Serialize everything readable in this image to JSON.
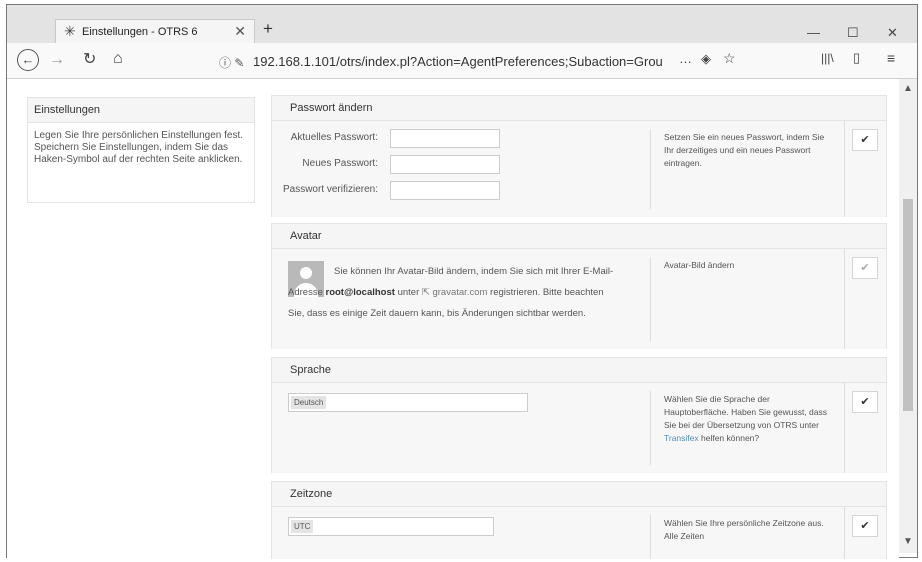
{
  "browser": {
    "tab_title": "Einstellungen - OTRS 6",
    "url_display": "192.168.1.101/otrs/index.pl?Action=AgentPreferences;Subaction=Grou",
    "page_actions": "…",
    "new_tab": "+",
    "minimize": "—",
    "maximize": "☐",
    "close": "✕"
  },
  "sidebar": {
    "title": "Einstellungen",
    "text": "Legen Sie Ihre persönlichen Einstellungen fest. Speichern Sie Einstellungen, indem Sie das Haken-Symbol auf der rechten Seite anklicken."
  },
  "password": {
    "title": "Passwort ändern",
    "current_label": "Aktuelles Passwort:",
    "new_label": "Neues Passwort:",
    "verify_label": "Passwort verifizieren:",
    "help": "Setzen Sie ein neues Passwort, indem Sie Ihr derzeitiges und ein neues Passwort eintragen."
  },
  "avatar": {
    "title": "Avatar",
    "text_before": "Sie können Ihr Avatar-Bild ändern, indem Sie sich mit Ihrer E-Mail-Adresse ",
    "email": "root@localhost",
    "text_mid": " unter ",
    "link": "gravatar.com",
    "text_after": " registrieren. Bitte beachten Sie, dass es einige Zeit dauern kann, bis Änderungen sichtbar werden.",
    "help": "Avatar-Bild ändern"
  },
  "language": {
    "title": "Sprache",
    "value": "Deutsch",
    "help": "Wählen Sie die Sprache der Hauptoberfläche. Haben Sie gewusst, dass Sie bei der Übersetzung von OTRS unter ",
    "help_link": "Transifex",
    "help_after": " helfen können?"
  },
  "timezone": {
    "title": "Zeitzone",
    "value": "UTC",
    "help": "Wählen Sie Ihre persönliche Zeitzone aus. Alle Zeiten"
  },
  "icons": {
    "save": "checkmark-icon",
    "back": "arrow-left-icon",
    "forward": "arrow-right-icon",
    "reload": "reload-icon",
    "home": "home-icon"
  }
}
